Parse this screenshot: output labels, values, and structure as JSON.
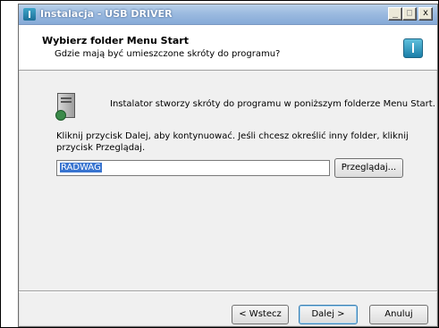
{
  "window": {
    "title": "Instalacja - USB DRIVER",
    "controls": {
      "minimize": "_",
      "maximize": "□",
      "close": "x"
    }
  },
  "header": {
    "title": "Wybierz folder Menu Start",
    "subtitle": "Gdzie mają być umieszczone skróty do programu?",
    "icon": "usb-installer-icon"
  },
  "body": {
    "intro_icon": "computer-shortcut-icon",
    "intro_text": "Instalator stworzy skróty do programu w poniższym folderze Menu Start.",
    "instructions": "Kliknij przycisk Dalej, aby kontynuować. Jeśli chcesz określić inny folder, kliknij przycisk Przeglądaj.",
    "folder_value": "RADWAG",
    "browse_label": "Przeglądaj..."
  },
  "footer": {
    "back_label": "< Wstecz",
    "next_label": "Dalej >",
    "cancel_label": "Anuluj"
  }
}
